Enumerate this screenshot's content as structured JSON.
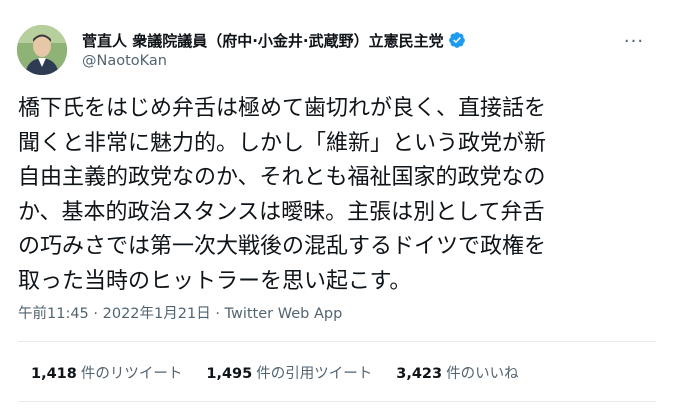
{
  "author": {
    "display_name": "菅直人 衆議院議員（府中·小金井·武蔵野）立憲民主党",
    "handle": "@NaotoKan",
    "verified": true
  },
  "more_button": "···",
  "tweet": {
    "lines": [
      "橋下氏をはじめ弁舌は極めて歯切れが良く、直接話を",
      "聞くと非常に魅力的。しかし「維新」という政党が新",
      "自由主義的政党なのか、それとも福祉国家的政党なの",
      "か、基本的政治スタンスは曖昧。主張は別として弁舌",
      "の巧みさでは第一次大戦後の混乱するドイツで政権を",
      "取った当時のヒットラーを思い起こす。"
    ]
  },
  "meta": {
    "time": "午前11:45",
    "separator": "·",
    "date": "2022年1月21日",
    "app": "Twitter Web App"
  },
  "stats": {
    "retweets": {
      "count": "1,418",
      "label": "件のリツイート"
    },
    "quotes": {
      "count": "1,495",
      "label": "件の引用ツイート"
    },
    "likes": {
      "count": "3,423",
      "label": "件のいいね"
    }
  },
  "colors": {
    "text": "#0f1419",
    "secondary": "#536471",
    "verified_badge": "#1d9bf0",
    "divider": "#e5eaec"
  }
}
